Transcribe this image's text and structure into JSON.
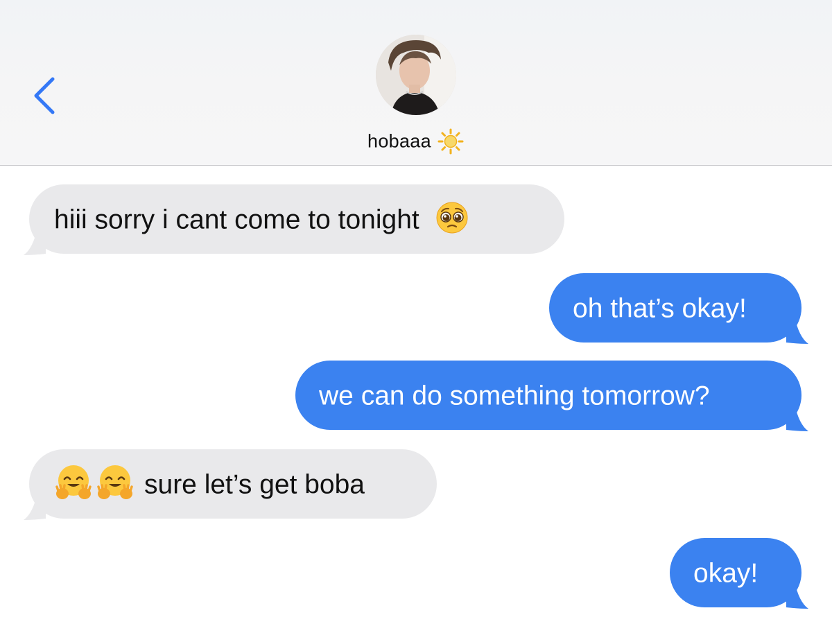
{
  "header": {
    "back_icon": "chevron-left-icon",
    "contact_name": "hobaaa",
    "contact_emoji": "sun-icon",
    "accent_color": "#3478f6"
  },
  "messages": [
    {
      "direction": "incoming",
      "text": "hiii sorry i cant come to tonight",
      "trailing_emoji": "pleading-face-icon"
    },
    {
      "direction": "outgoing",
      "text": "oh that’s okay!"
    },
    {
      "direction": "outgoing",
      "text": "we can do something tomorrow?"
    },
    {
      "direction": "incoming",
      "leading_emoji": [
        "hugging-face-icon",
        "hugging-face-icon"
      ],
      "text": "sure let’s get boba"
    },
    {
      "direction": "outgoing",
      "text": "okay!"
    }
  ],
  "colors": {
    "incoming_bubble": "#e9e9eb",
    "outgoing_bubble": "#3b82f0",
    "header_bg": "#f3f4f6"
  }
}
